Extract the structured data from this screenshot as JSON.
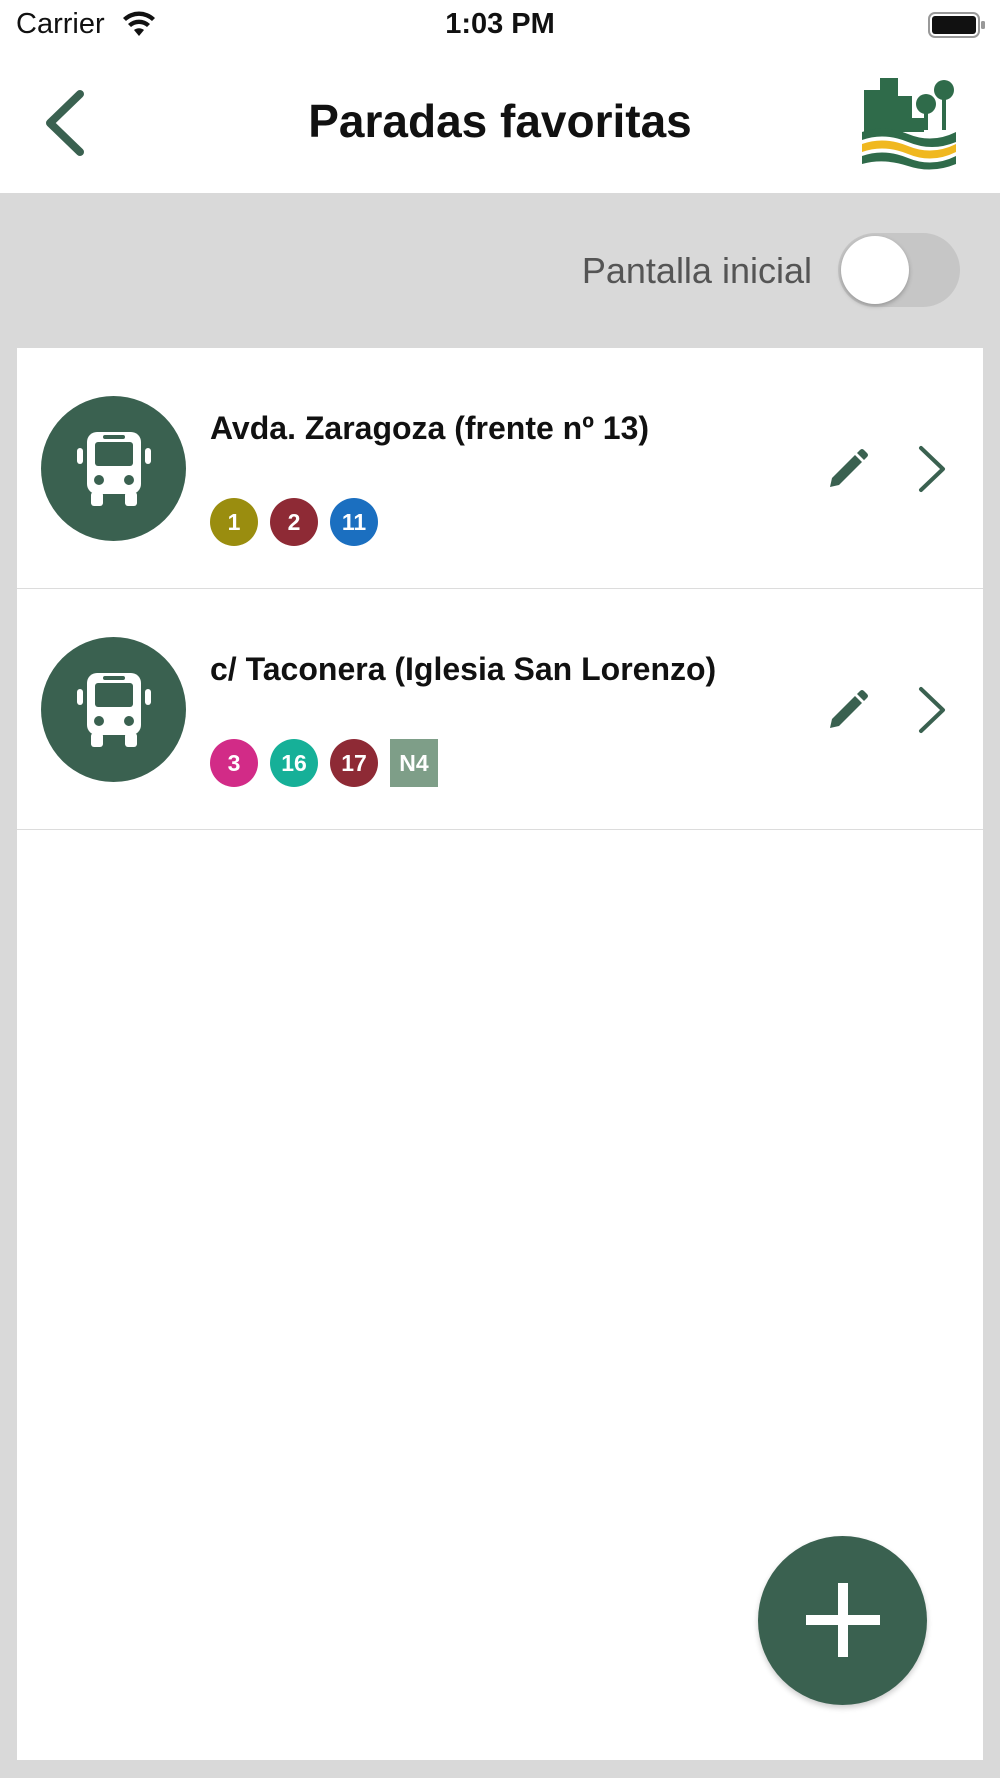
{
  "status_bar": {
    "carrier": "Carrier",
    "time": "1:03 PM"
  },
  "header": {
    "title": "Paradas favoritas",
    "back_icon": "chevron-left-icon",
    "logo_icon": "city-river-logo-icon"
  },
  "settings": {
    "initial_screen_label": "Pantalla inicial",
    "initial_screen_enabled": false
  },
  "stops": [
    {
      "name": "Avda. Zaragoza (frente nº 13)",
      "icon": "bus-icon",
      "lines": [
        {
          "label": "1",
          "color": "#9a8d0f",
          "shape": "circle"
        },
        {
          "label": "2",
          "color": "#8e2a35",
          "shape": "circle"
        },
        {
          "label": "11",
          "color": "#1b6fc0",
          "shape": "circle"
        }
      ]
    },
    {
      "name": "c/ Taconera (Iglesia San Lorenzo)",
      "icon": "bus-icon",
      "lines": [
        {
          "label": "3",
          "color": "#d22b87",
          "shape": "circle"
        },
        {
          "label": "16",
          "color": "#16b098",
          "shape": "circle"
        },
        {
          "label": "17",
          "color": "#8e2a35",
          "shape": "circle"
        },
        {
          "label": "N4",
          "color": "#7e9e88",
          "shape": "square"
        }
      ]
    }
  ],
  "fab": {
    "icon": "plus-icon"
  },
  "colors": {
    "accent": "#3a6150",
    "background": "#d9d9d9"
  }
}
